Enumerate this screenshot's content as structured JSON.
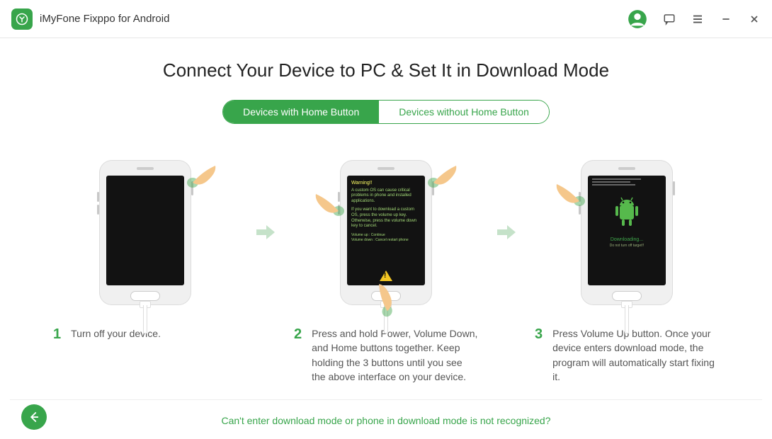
{
  "app": {
    "title": "iMyFone Fixppo for Android"
  },
  "page": {
    "title": "Connect Your Device to PC & Set It in Download Mode"
  },
  "toggle": {
    "active_label": "Devices with Home Button",
    "inactive_label": "Devices without Home Button"
  },
  "steps": [
    {
      "num": "1",
      "desc": "Turn off your device."
    },
    {
      "num": "2",
      "desc": "Press and hold Power, Volume Down, and Home buttons together. Keep holding the 3 buttons until you see the above interface on your device."
    },
    {
      "num": "3",
      "desc": "Press Volume Up button. Once your device enters download mode, the program will automatically start fixing it."
    }
  ],
  "phone2": {
    "warning_header": "Warning!!",
    "warning_body1": "A custom OS can cause critical problems in phone and installed applications.",
    "warning_body2": "If you want to download a custom OS, press the volume up key. Otherwise, press the volume down key to cancel.",
    "vol_up": "Volume up : Continue",
    "vol_down": "Volume down : Cancel restart phone"
  },
  "phone3": {
    "downloading": "Downloading...",
    "subtext": "Do not turn off target!!"
  },
  "footer": {
    "link": "Can't enter download mode or phone in download mode is not recognized?"
  },
  "icons": {
    "account": "account-icon",
    "feedback": "feedback-icon",
    "menu": "menu-icon",
    "minimize": "minimize-icon",
    "close": "close-icon",
    "arrow": "arrow-right-icon",
    "back": "back-arrow-icon"
  }
}
